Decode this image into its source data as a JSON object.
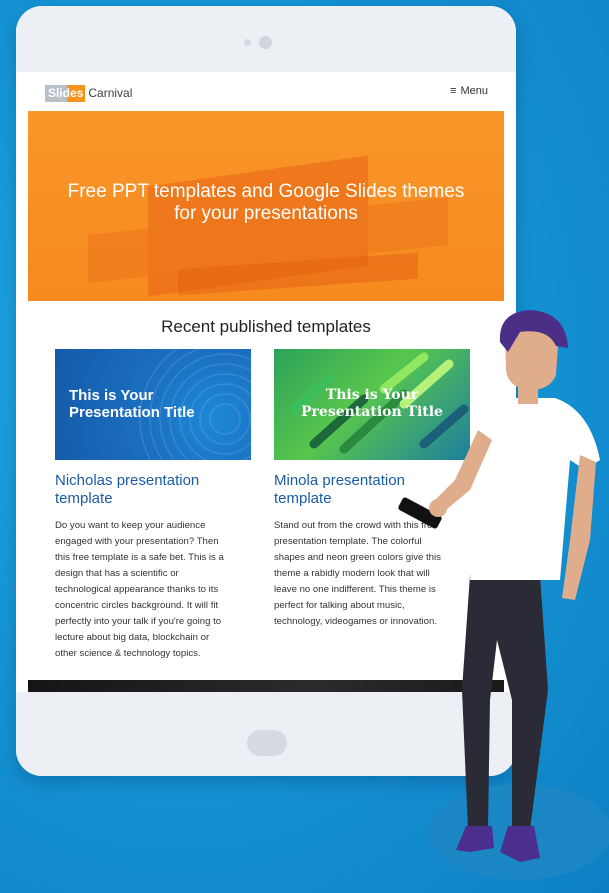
{
  "site": {
    "logo_part1": "Slides",
    "logo_part2": "Carnival",
    "menu_label": "Menu"
  },
  "hero": {
    "title_line1": "Free PPT templates and Google Slides themes",
    "title_line2": "for your presentations"
  },
  "section": {
    "title": "Recent published templates"
  },
  "cards": [
    {
      "thumb_line1": "This is Your",
      "thumb_line2": "Presentation Title",
      "title_line1": "Nicholas presentation",
      "title_line2": "template",
      "desc_lines": [
        "Do you want to keep your audience",
        "engaged with your presentation? Then",
        "this free template is a safe bet. This is a",
        "design that has a scientific or",
        "technological appearance thanks to its",
        "concentric circles background. It will fit",
        "perfectly into your talk if you're going to",
        "lecture about big data, blockchain or",
        "other science & technology topics."
      ]
    },
    {
      "thumb_line1": "This is Your",
      "thumb_line2": "Presentation Title",
      "title_line1": "Minola presentation",
      "title_line2": "template",
      "desc_lines": [
        "Stand out from the crowd with this free",
        "presentation template. The colorful",
        "shapes and neon green colors give this",
        "theme a rabidly modern look that will",
        "leave no one indifferent. This theme is",
        "perfect for talking about music,",
        "technology, videogames or innovation."
      ]
    }
  ],
  "colors": {
    "background": "#1697d6",
    "accent_orange": "#f68a1f",
    "link_blue": "#1a5ca6"
  }
}
